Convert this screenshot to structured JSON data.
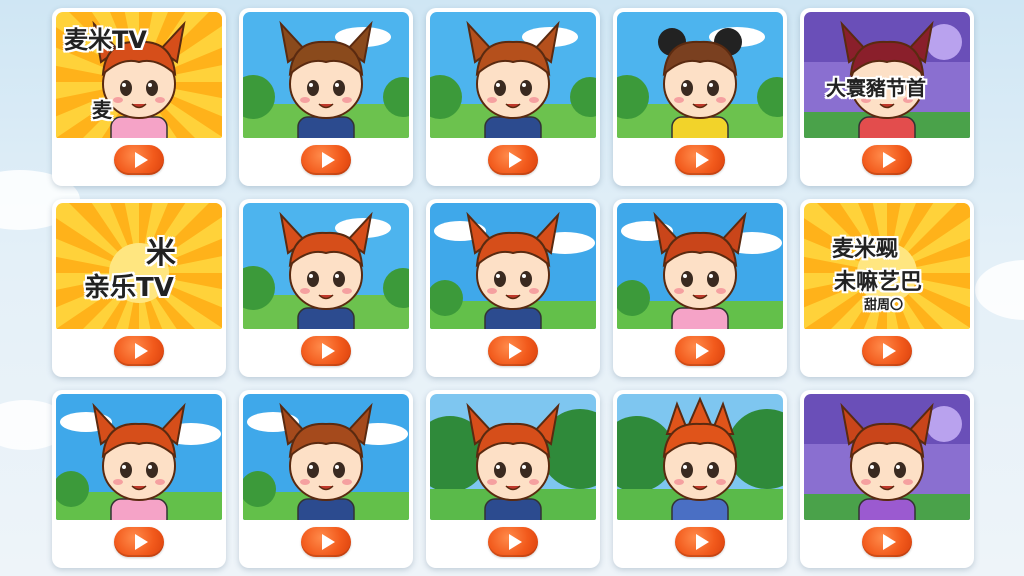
{
  "colors": {
    "accent": "#f25a1c",
    "card": "#ffffff",
    "background": "#dbeaf5"
  },
  "cards": [
    {
      "scene": "sunburst",
      "hair": "#d64e1a",
      "ears": "horn",
      "shirt": "#f5a3c7",
      "texts": [
        "麦米TV",
        "麦"
      ]
    },
    {
      "scene": "meadow",
      "hair": "#8a4a1c",
      "ears": "horn",
      "shirt": "#2c4b8f",
      "texts": []
    },
    {
      "scene": "meadow",
      "hair": "#b5501c",
      "ears": "horn",
      "shirt": "#2c4b8f",
      "texts": []
    },
    {
      "scene": "meadow",
      "hair": "#7a4020",
      "ears": "mouse",
      "shirt": "#f2d32a",
      "texts": []
    },
    {
      "scene": "purple",
      "hair": "#8a1f2b",
      "ears": "horn",
      "shirt": "#e34d4d",
      "texts": [
        "大寰豬节首"
      ]
    },
    {
      "scene": "sunburst",
      "hair": "#d64e1a",
      "ears": "none",
      "shirt": "#ffffff",
      "texts": [
        "米",
        "亲乐TV"
      ]
    },
    {
      "scene": "meadow",
      "hair": "#d64e1a",
      "ears": "horn",
      "shirt": "#2c4b8f",
      "texts": []
    },
    {
      "scene": "sky",
      "hair": "#d64e1a",
      "ears": "horn",
      "shirt": "#2c4b8f",
      "texts": []
    },
    {
      "scene": "sky",
      "hair": "#c9451a",
      "ears": "horn",
      "shirt": "#f5a3c7",
      "texts": []
    },
    {
      "scene": "sunburst",
      "hair": "#d64e1a",
      "ears": "none",
      "shirt": "#ffffff",
      "texts": [
        "麦米觋",
        "未嘛艺巴",
        "甜周〇"
      ]
    },
    {
      "scene": "sky",
      "hair": "#d64e1a",
      "ears": "horn",
      "shirt": "#f5a3c7",
      "texts": []
    },
    {
      "scene": "sky",
      "hair": "#a54a1c",
      "ears": "horn",
      "shirt": "#2c4b8f",
      "texts": []
    },
    {
      "scene": "forest",
      "hair": "#d64e1a",
      "ears": "horn",
      "shirt": "#2c4b8f",
      "texts": []
    },
    {
      "scene": "forest",
      "hair": "#e0541a",
      "ears": "spiky",
      "shirt": "#4a6fc4",
      "texts": []
    },
    {
      "scene": "purple",
      "hair": "#c9451a",
      "ears": "horn",
      "shirt": "#9b5ad0",
      "texts": []
    }
  ]
}
